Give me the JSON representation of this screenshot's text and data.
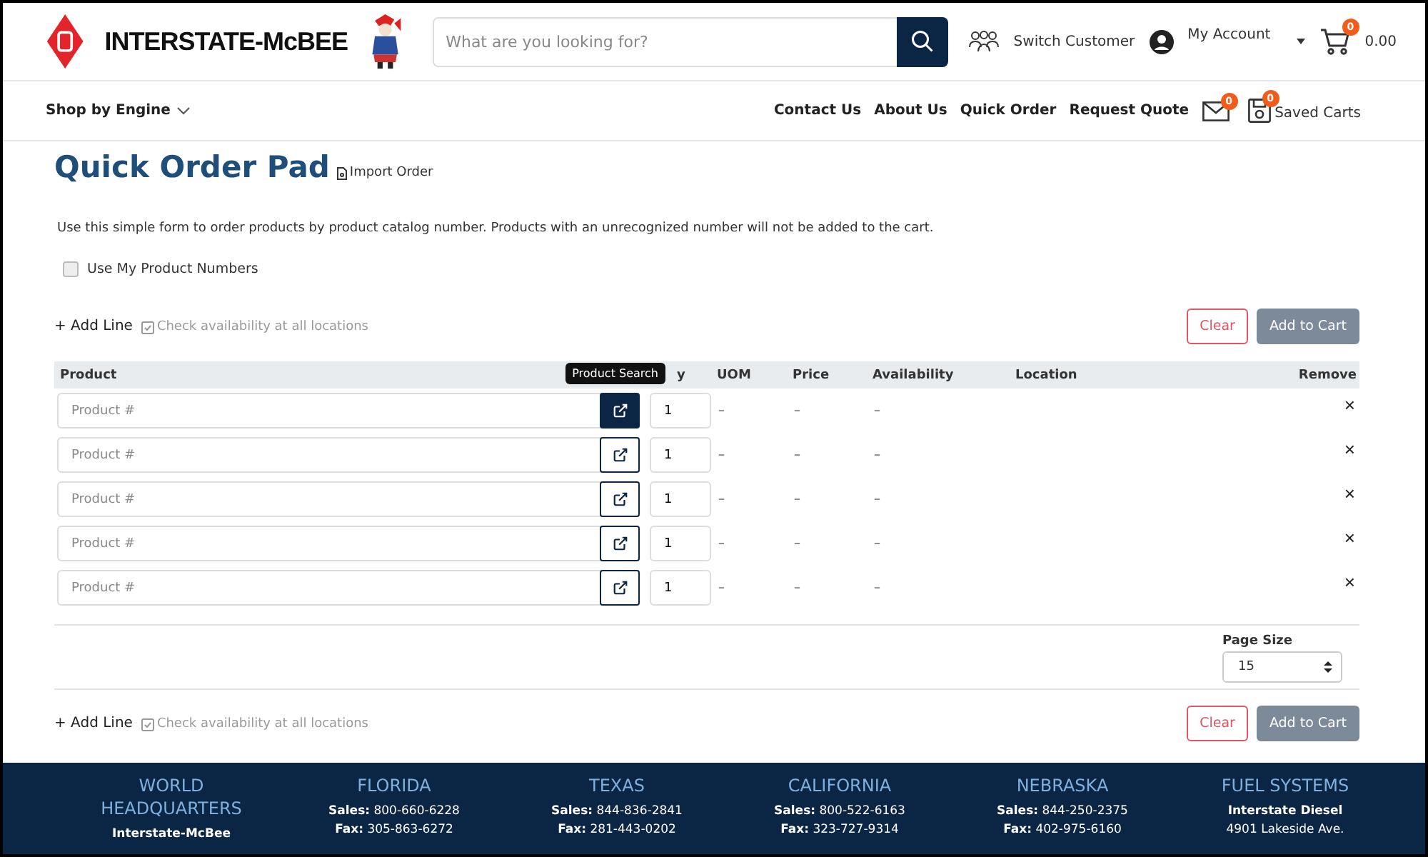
{
  "header": {
    "logo_text": "INTERSTATE-McBEE",
    "search": {
      "placeholder": "What are you looking for?"
    },
    "switch_customer": "Switch Customer",
    "my_account": "My Account",
    "cart": {
      "count": "0",
      "total": "0.00"
    }
  },
  "nav": {
    "shop_by_engine": "Shop by Engine",
    "links": [
      "Contact Us",
      "About Us",
      "Quick Order",
      "Request Quote"
    ],
    "messages_count": "0",
    "saved_carts": {
      "count": "0",
      "label": "Saved Carts"
    }
  },
  "page": {
    "title": "Quick Order Pad",
    "import_order": "Import Order",
    "description": "Use this simple form to order products by product catalog number. Products with an unrecognized number will not be added to the cart.",
    "use_my_numbers": {
      "label": "Use My Product Numbers",
      "checked": false
    }
  },
  "toolbars": [
    {
      "add_line": "+ Add Line",
      "check_availability": "Check availability at all locations",
      "clear": "Clear",
      "add_to_cart": "Add to Cart"
    },
    {
      "add_line": "+ Add Line",
      "check_availability": "Check availability at all locations",
      "clear": "Clear",
      "add_to_cart": "Add to Cart"
    }
  ],
  "table": {
    "columns": [
      "Product",
      "y",
      "UOM",
      "Price",
      "Availability",
      "Location",
      "Remove"
    ],
    "rows": [
      {
        "placeholder": "Product #",
        "search_active": true,
        "qty": "1",
        "uom": "–",
        "price": "–",
        "availability": "–"
      },
      {
        "placeholder": "Product #",
        "search_active": false,
        "qty": "1",
        "uom": "–",
        "price": "–",
        "availability": "–"
      },
      {
        "placeholder": "Product #",
        "search_active": false,
        "qty": "1",
        "uom": "–",
        "price": "–",
        "availability": "–"
      },
      {
        "placeholder": "Product #",
        "search_active": false,
        "qty": "1",
        "uom": "–",
        "price": "–",
        "availability": "–"
      },
      {
        "placeholder": "Product #",
        "search_active": false,
        "qty": "1",
        "uom": "–",
        "price": "–",
        "availability": "–"
      }
    ],
    "tooltip": "Product Search",
    "remove_glyph": "×"
  },
  "page_size": {
    "label": "Page Size",
    "value": "15"
  },
  "footer": [
    {
      "title": "WORLD HEADQUARTERS",
      "lines": [
        {
          "label": "Interstate-McBee"
        }
      ]
    },
    {
      "title": "FLORIDA",
      "lines": [
        {
          "label": "Sales:",
          "value": "800-660-6228"
        },
        {
          "label": "Fax:",
          "value": "305-863-6272"
        }
      ]
    },
    {
      "title": "TEXAS",
      "lines": [
        {
          "label": "Sales:",
          "value": "844-836-2841"
        },
        {
          "label": "Fax:",
          "value": "281-443-0202"
        }
      ]
    },
    {
      "title": "CALIFORNIA",
      "lines": [
        {
          "label": "Sales:",
          "value": "800-522-6163"
        },
        {
          "label": "Fax:",
          "value": "323-727-9314"
        }
      ]
    },
    {
      "title": "NEBRASKA",
      "lines": [
        {
          "label": "Sales:",
          "value": "844-250-2375"
        },
        {
          "label": "Fax:",
          "value": "402-975-6160"
        }
      ]
    },
    {
      "title": "FUEL SYSTEMS",
      "lines": [
        {
          "label": "Interstate Diesel"
        },
        {
          "value": "4901 Lakeside Ave."
        }
      ]
    }
  ]
}
